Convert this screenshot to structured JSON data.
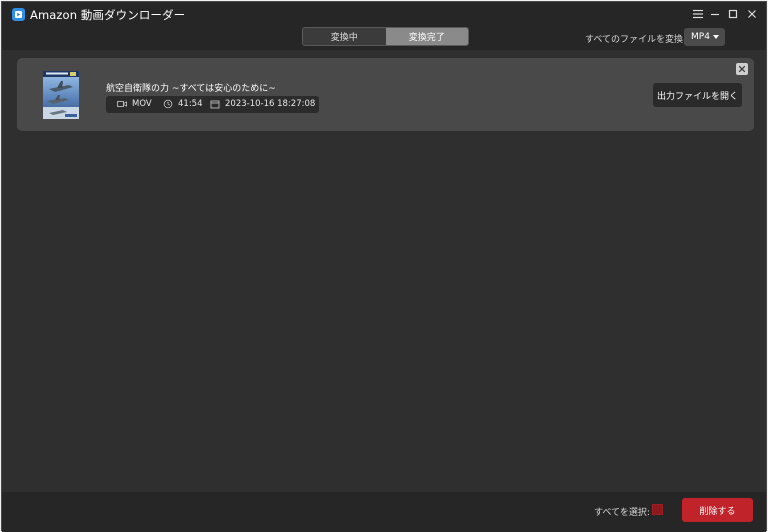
{
  "app": {
    "title": "Amazon 動画ダウンローダー",
    "icon": "play-icon",
    "accent_color": "#2f8fe6"
  },
  "window_controls": [
    "menu-icon",
    "minimize-icon",
    "maximize-icon",
    "close-icon"
  ],
  "tabs": [
    {
      "label": "変換中",
      "active": false
    },
    {
      "label": "変換完了",
      "active": true
    }
  ],
  "toolbar": {
    "convert_all_label": "すべてのファイルを変換:",
    "format_value": "MP4"
  },
  "items": [
    {
      "title": "航空自衛隊の力 ~すべては安心のために~",
      "format": "MOV",
      "duration": "41:54",
      "date": "2023-10-16 18:27:08",
      "open_button": "出力ファイルを開く"
    }
  ],
  "footer": {
    "select_all_label": "すべてを選択:",
    "delete_button": "削除する",
    "danger_color": "#c0232a"
  }
}
